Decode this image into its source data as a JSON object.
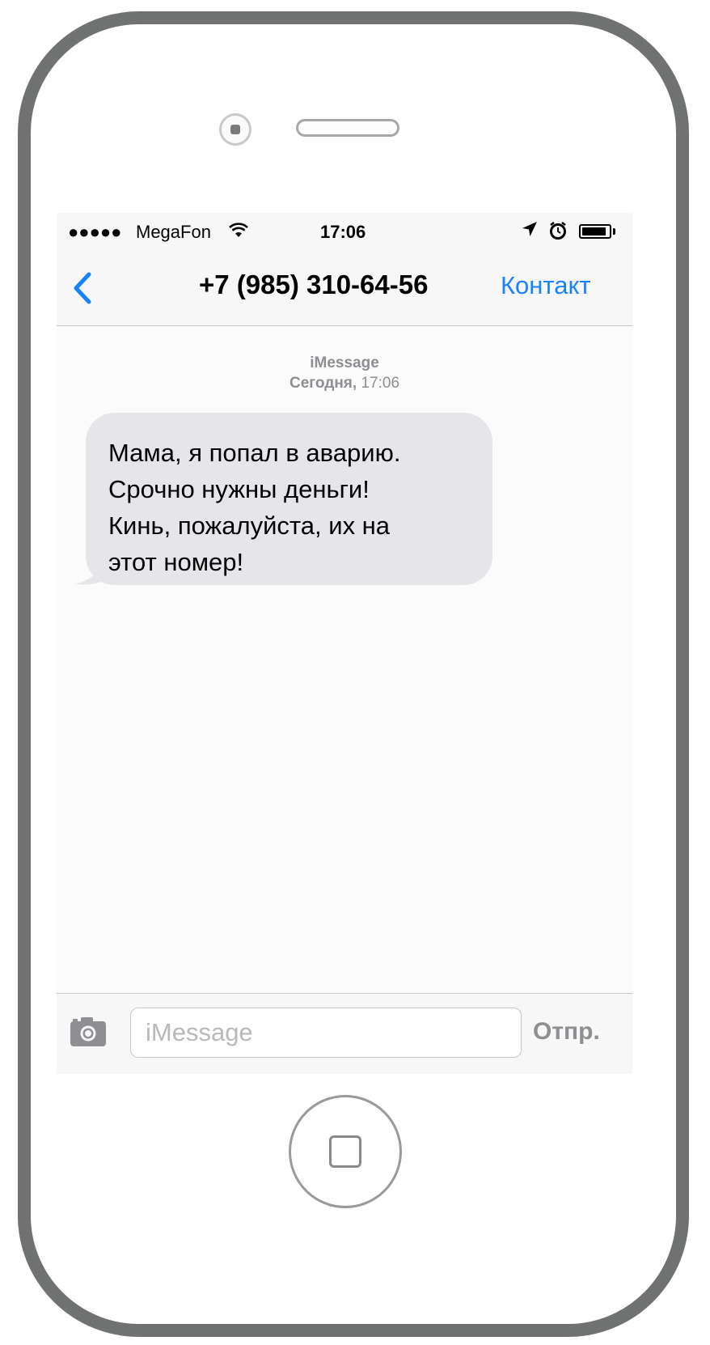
{
  "status_bar": {
    "signal": "●●●●●",
    "carrier": "MegaFon",
    "wifi_icon": "wifi-icon",
    "time": "17:06",
    "location_icon": "location-arrow-icon",
    "alarm_icon": "alarm-clock-icon",
    "battery_level": 0.9
  },
  "nav": {
    "back_icon": "chevron-left-icon",
    "title": "+7 (985) 310-64-56",
    "contact_label": "Контакт"
  },
  "conversation": {
    "service": "iMessage",
    "day": "Сегодня,",
    "time": "17:06",
    "messages": [
      {
        "direction": "incoming",
        "lines": [
          "Мама, я попал в аварию.",
          "Срочно нужны деньги!",
          "Кинь, пожалуйста, их на",
          "этот номер!"
        ]
      }
    ]
  },
  "composer": {
    "camera_icon": "camera-icon",
    "placeholder": "iMessage",
    "value": "",
    "send_label": "Отпр."
  },
  "colors": {
    "accent": "#1a82fb",
    "bubble_incoming": "#e5e5ea",
    "secondary_text": "#8e8e93",
    "bezel": "#6f7270"
  }
}
